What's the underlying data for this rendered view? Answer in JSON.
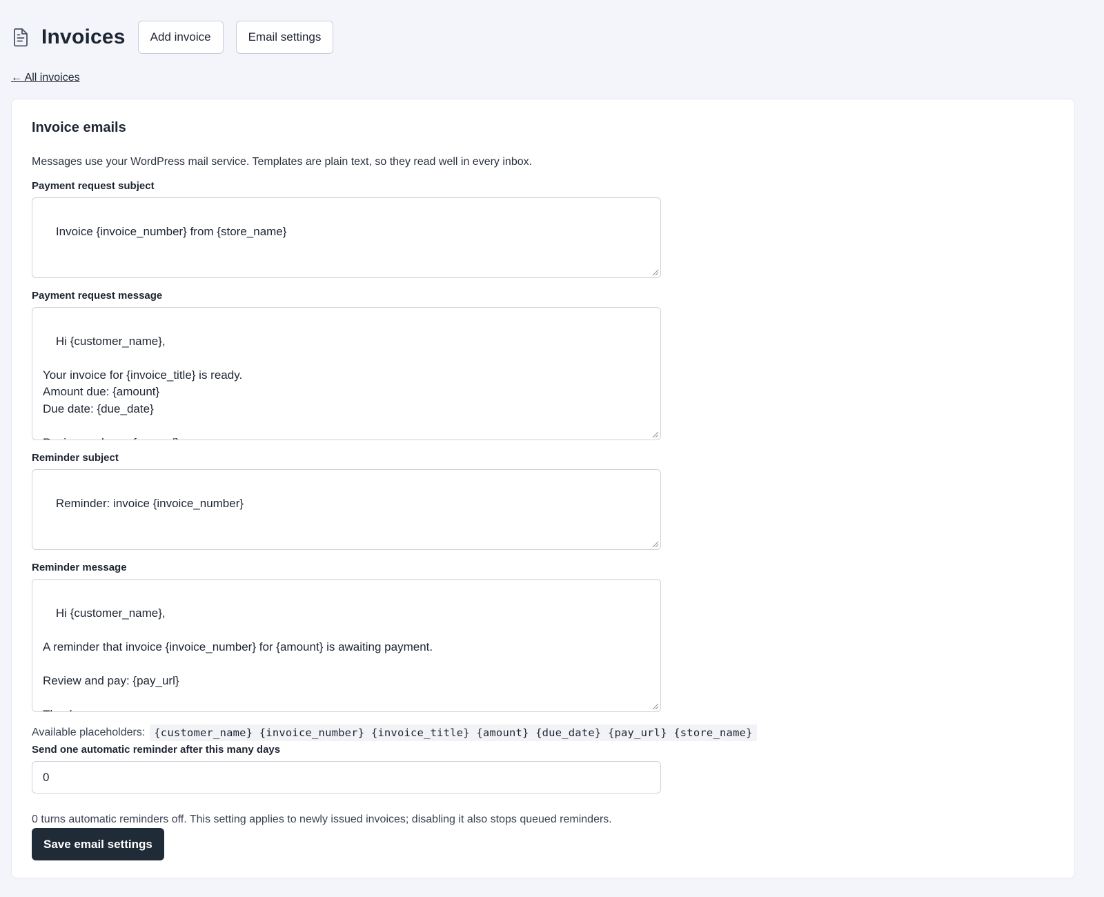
{
  "header": {
    "title": "Invoices",
    "page_icon": "document-icon",
    "add_invoice_label": "Add invoice",
    "email_settings_label": "Email settings"
  },
  "back_link": "← All invoices",
  "card": {
    "title": "Invoice emails",
    "intro": "Messages use your WordPress mail service. Templates are plain text, so they read well in every inbox."
  },
  "fields": {
    "payment_subject": {
      "label": "Payment request subject",
      "value": "Invoice {invoice_number} from {store_name}"
    },
    "payment_message": {
      "label": "Payment request message",
      "value": "Hi {customer_name},\n\nYour invoice for {invoice_title} is ready.\nAmount due: {amount}\nDue date: {due_date}\n\nReview and pay: {pay_url}"
    },
    "reminder_subject": {
      "label": "Reminder subject",
      "value": "Reminder: invoice {invoice_number}"
    },
    "reminder_message": {
      "label": "Reminder message",
      "value": "Hi {customer_name},\n\nA reminder that invoice {invoice_number} for {amount} is awaiting payment.\n\nReview and pay: {pay_url}\n\nThank you,\n{store_name}"
    }
  },
  "placeholders": {
    "label": "Available placeholders:",
    "codes": "{customer_name} {invoice_number} {invoice_title} {amount} {due_date} {pay_url} {store_name}"
  },
  "reminder_days": {
    "label": "Send one automatic reminder after this many days",
    "value": "0",
    "hint": "0 turns automatic reminders off. This setting applies to newly issued invoices; disabling it also stops queued reminders."
  },
  "save_label": "Save email settings",
  "colors": {
    "background": "#f3f5fb",
    "card": "#ffffff",
    "primary_button": "#202b38",
    "text": "#1e2532"
  }
}
